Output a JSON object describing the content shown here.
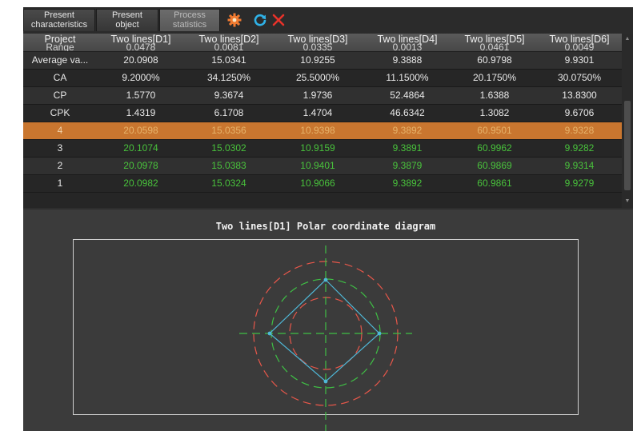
{
  "tabs": [
    {
      "line1": "Present",
      "line2": "characteristics",
      "active": false
    },
    {
      "line1": "Present",
      "line2": "object",
      "active": false
    },
    {
      "line1": "Process",
      "line2": "statistics",
      "active": true
    }
  ],
  "toolbar": {
    "settings_icon": "gear-icon",
    "refresh_icon": "refresh-icon",
    "close_icon": "close-icon"
  },
  "colors": {
    "accent_orange": "#c9762f",
    "pass_green": "#49c23c",
    "limit_red": "#e8574a",
    "guide_green": "#3fbf45",
    "measure_cyan": "#4fb7d6"
  },
  "table": {
    "header": {
      "first": "Project",
      "first_sub": "Range",
      "columns": [
        {
          "name": "Two lines[D1]",
          "sub": "0.0478"
        },
        {
          "name": "Two lines[D2]",
          "sub": "0.0081"
        },
        {
          "name": "Two lines[D3]",
          "sub": "0.0335"
        },
        {
          "name": "Two lines[D4]",
          "sub": "0.0013"
        },
        {
          "name": "Two lines[D5]",
          "sub": "0.0461"
        },
        {
          "name": "Two lines[D6]",
          "sub": "0.0049"
        }
      ]
    },
    "rows": [
      {
        "label": "Average va...",
        "values": [
          "20.0908",
          "15.0341",
          "10.9255",
          "9.3888",
          "60.9798",
          "9.9301"
        ],
        "style": "odd"
      },
      {
        "label": "CA",
        "values": [
          "9.2000%",
          "34.1250%",
          "25.5000%",
          "11.1500%",
          "20.1750%",
          "30.0750%"
        ],
        "style": "even"
      },
      {
        "label": "CP",
        "values": [
          "1.5770",
          "9.3674",
          "1.9736",
          "52.4864",
          "1.6388",
          "13.8300"
        ],
        "style": "odd"
      },
      {
        "label": "CPK",
        "values": [
          "1.4319",
          "6.1708",
          "1.4704",
          "46.6342",
          "1.3082",
          "9.6706"
        ],
        "style": "even"
      },
      {
        "label": "4",
        "values": [
          "20.0598",
          "15.0356",
          "10.9398",
          "9.3892",
          "60.9501",
          "9.9328"
        ],
        "style": "sel"
      },
      {
        "label": "3",
        "values": [
          "20.1074",
          "15.0302",
          "10.9159",
          "9.3891",
          "60.9962",
          "9.9282"
        ],
        "style": "even",
        "green": true
      },
      {
        "label": "2",
        "values": [
          "20.0978",
          "15.0383",
          "10.9401",
          "9.3879",
          "60.9869",
          "9.9314"
        ],
        "style": "odd",
        "green": true
      },
      {
        "label": "1",
        "values": [
          "20.0982",
          "15.0324",
          "10.9066",
          "9.3892",
          "60.9861",
          "9.9279"
        ],
        "style": "even",
        "green": true
      }
    ]
  },
  "diagram": {
    "title": "Two lines[D1] Polar coordinate diagram"
  }
}
